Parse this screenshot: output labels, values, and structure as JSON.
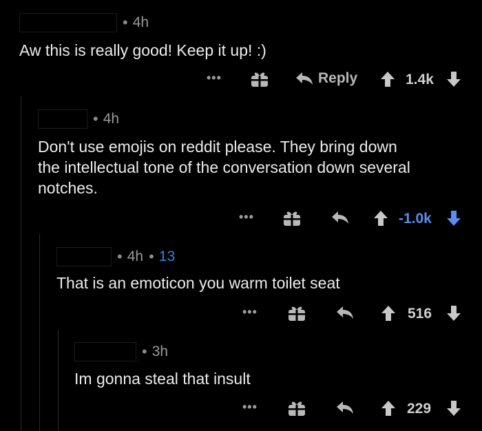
{
  "colors": {
    "background": "#000000",
    "text": "#ececec",
    "meta": "#9a9a9a",
    "downvote_accent": "#5a8ef0",
    "award_count": "#3a82e6"
  },
  "comments": [
    {
      "time": "4h",
      "body": "Aw this is really good! Keep it up! :)",
      "reply_label": "Reply",
      "score": "1.4k",
      "score_state": "neutral"
    },
    {
      "time": "4h",
      "body": "Don't use emojis on reddit please. They bring down\nthe intellectual tone of the conversation down several\nnotches.",
      "score": "-1.0k",
      "score_state": "downvoted"
    },
    {
      "time": "4h",
      "awards": "13",
      "body": "That is an emoticon you warm toilet seat",
      "score": "516",
      "score_state": "neutral"
    },
    {
      "time": "3h",
      "body": "Im gonna steal that insult",
      "score": "229",
      "score_state": "neutral"
    }
  ],
  "icons": {
    "more": "more-options-icon",
    "award": "gift-award-icon",
    "reply": "reply-arrow-icon",
    "upvote": "upvote-arrow-icon",
    "downvote": "downvote-arrow-icon"
  }
}
